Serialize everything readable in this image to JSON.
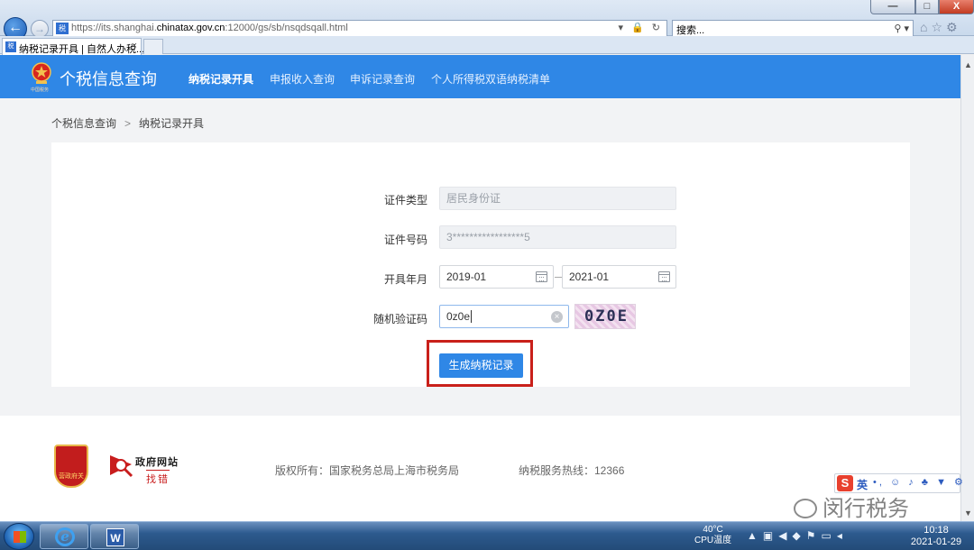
{
  "browser": {
    "url_prefix": "https://its.shanghai.",
    "url_domain": "chinatax.gov.cn",
    "url_suffix": ":12000/gs/sb/nsqdsqall.html",
    "search_placeholder": "搜索...",
    "tab_title": "纳税记录开具 | 自然人办税...",
    "site_icon_text": "税",
    "window_close": "X",
    "window_max": "□",
    "window_min": "—"
  },
  "header": {
    "site_title": "个税信息查询",
    "emblem_caption": "中国税务",
    "nav": [
      {
        "label": "纳税记录开具",
        "active": true
      },
      {
        "label": "申报收入查询",
        "active": false
      },
      {
        "label": "申诉记录查询",
        "active": false
      },
      {
        "label": "个人所得税双语纳税清单",
        "active": false
      }
    ]
  },
  "breadcrumb": {
    "root": "个税信息查询",
    "separator": ">",
    "current": "纳税记录开具"
  },
  "form": {
    "id_type_label": "证件类型",
    "id_type_value": "居民身份证",
    "id_number_label": "证件号码",
    "id_number_value": "3*****************5",
    "period_label": "开具年月",
    "period_start": "2019-01",
    "period_end": "2021-01",
    "captcha_label": "随机验证码",
    "captcha_input": "0z0e",
    "captcha_image_text": "0Z0E",
    "submit_label": "生成纳税记录"
  },
  "footer": {
    "emblem_text": "营政府关",
    "gov_site_line1": "政府网站",
    "gov_site_line2": "找错",
    "copyright": "版权所有：国家税务总局上海市税务局",
    "hotline": "纳税服务热线：12366"
  },
  "ime": {
    "logo": "S",
    "lang": "英",
    "icons": "•, ☺ ♪ ♣ ▼ ⚙"
  },
  "watermark": "闵行税务",
  "taskbar": {
    "cpu_temp": "40°C",
    "cpu_label": "CPU温度",
    "time": "10:18",
    "date": "2021-01-29",
    "ie_logo": "e",
    "word_logo": "W"
  },
  "colors": {
    "brand_blue": "#2f87e6",
    "highlight_red": "#c9201a"
  }
}
